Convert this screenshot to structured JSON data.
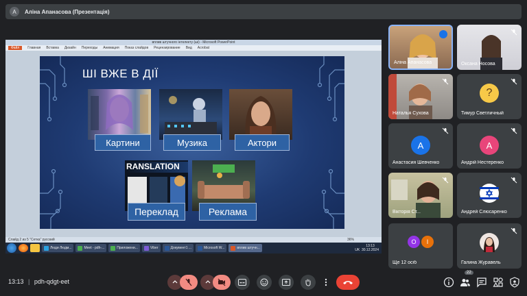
{
  "presenter_bar": {
    "avatar_letter": "A",
    "title": "Аліна Апанасова (Презентація)"
  },
  "ppt": {
    "window_title": "вплив штучного інтелекту (ші) - Microsoft PowerPoint",
    "menu": [
      "Файл",
      "Главная",
      "Вставка",
      "Дизайн",
      "Переходы",
      "Анимация",
      "Показ слайдов",
      "Рецензирование",
      "Вид",
      "Acrobat"
    ],
    "status_left": "Слайд 2 из 5   \"Сетка\"   русский",
    "zoom": "36%",
    "slide": {
      "title": "ШІ ВЖЕ В ДІЇ",
      "captions": {
        "pictures": "Картини",
        "music": "Музика",
        "actors": "Актори",
        "translation": "Переклад",
        "ads": "Реклама"
      },
      "translation_banner": "RANSLATION"
    },
    "taskbar": {
      "tasks": [
        "Люди Людм...",
        "Meet - pdh-...",
        "Приложени...",
        "Viber",
        "Документ1 ...",
        "Microsoft W...",
        "вплив штучн..."
      ],
      "lang": "UK",
      "time": "13:13",
      "date": "30.12.2024"
    }
  },
  "participants": [
    {
      "name": "Аліна Апанасова",
      "speaking": true
    },
    {
      "name": "Оксана Носова"
    },
    {
      "name": "Наталья Сухова"
    },
    {
      "name": "Тимур Светличный"
    },
    {
      "name": "Анастасия Шевченко",
      "letter": "А",
      "color": "#1a73e8"
    },
    {
      "name": "Андрій Нестеренко",
      "letter": "А",
      "color": "#e8457a"
    },
    {
      "name": "Вікторія Ст..."
    },
    {
      "name": "Андрей Слюсаренко"
    },
    {
      "name": "Ще 12 осіб",
      "letters": [
        "О",
        "І"
      ]
    },
    {
      "name": "Галина Журавель"
    }
  ],
  "bottom_bar": {
    "time": "13:13",
    "separator": "|",
    "meeting_code": "pdh-qdgt-eet",
    "participant_count": "22"
  },
  "colors": {
    "leave": "#ea4335",
    "muted": "#f28b82",
    "bg": "#202124",
    "tile": "#3c4043"
  }
}
